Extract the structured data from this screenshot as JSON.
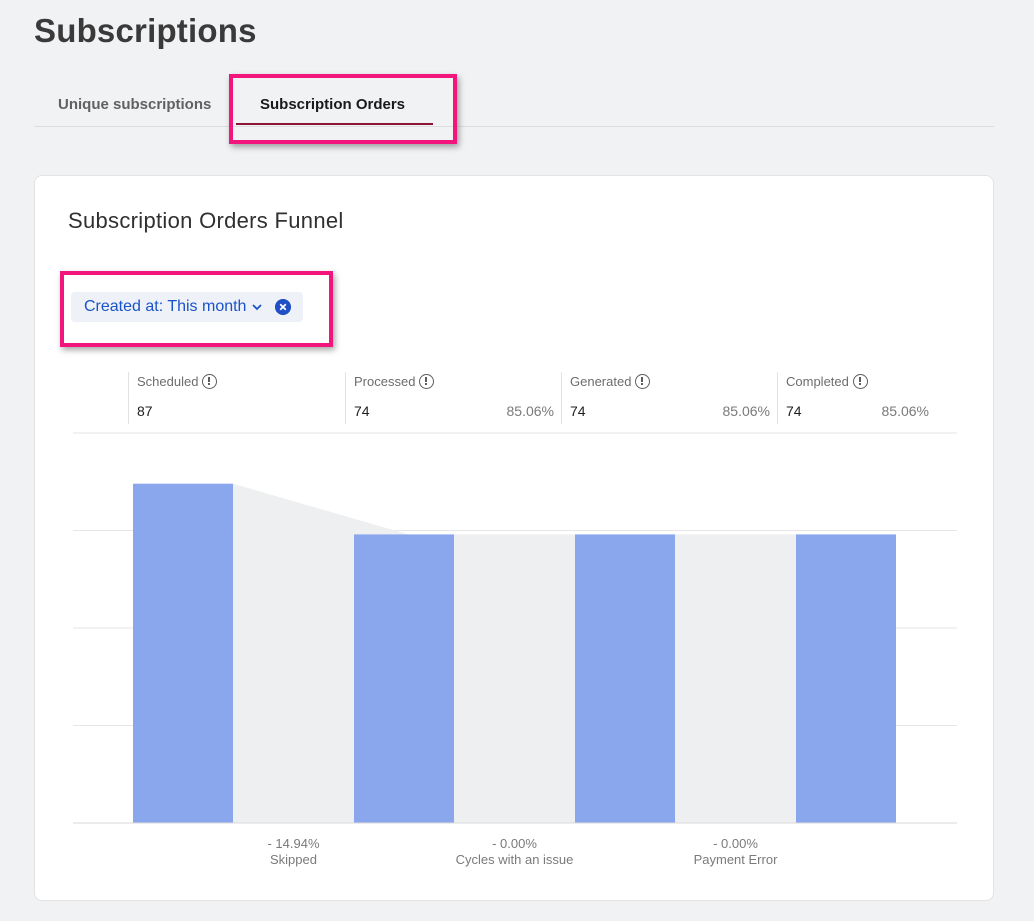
{
  "page": {
    "title": "Subscriptions"
  },
  "tabs": [
    {
      "label": "Unique subscriptions",
      "active": false
    },
    {
      "label": "Subscription Orders",
      "active": true
    }
  ],
  "card": {
    "title": "Subscription Orders Funnel",
    "filter": {
      "label": "Created at: This month",
      "icon_expand": "chevron-down-icon",
      "icon_clear": "close-circle-icon"
    }
  },
  "stats": [
    {
      "label": "Scheduled",
      "value": "87",
      "percent": ""
    },
    {
      "label": "Processed",
      "value": "74",
      "percent": "85.06%"
    },
    {
      "label": "Generated",
      "value": "74",
      "percent": "85.06%"
    },
    {
      "label": "Completed",
      "value": "74",
      "percent": "85.06%"
    }
  ],
  "colors": {
    "bar": "#8aa6ec",
    "drop_area": "#eeeff0",
    "accent": "#8c1236",
    "highlight": "#f2157c",
    "link": "#1a53c8"
  },
  "chart_data": {
    "type": "bar",
    "categories": [
      "Scheduled",
      "Processed",
      "Generated",
      "Completed"
    ],
    "values": [
      87,
      74,
      74,
      74
    ],
    "ylim": [
      0,
      100
    ],
    "grid": true,
    "drops": [
      {
        "percent": "- 14.94%",
        "label": "Skipped"
      },
      {
        "percent": "- 0.00%",
        "label": "Cycles with an issue"
      },
      {
        "percent": "- 0.00%",
        "label": "Payment Error"
      }
    ]
  }
}
